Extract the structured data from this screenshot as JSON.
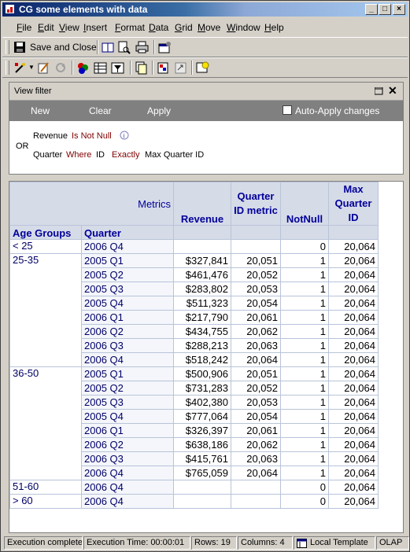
{
  "window": {
    "title": "CG some elements with data",
    "min_label": "_",
    "max_label": "□",
    "close_label": "×"
  },
  "menu": [
    "File",
    "Edit",
    "View",
    "Insert",
    "Format",
    "Data",
    "Grid",
    "Move",
    "Window",
    "Help"
  ],
  "toolbar": {
    "save_close_label": "Save and Close"
  },
  "view_filter": {
    "title": "View filter",
    "actions": {
      "new": "New",
      "clear": "Clear",
      "apply": "Apply",
      "auto_apply": "Auto-Apply changes"
    },
    "or_label": "OR",
    "condition1": {
      "field": "Revenue",
      "op": "Is Not Null"
    },
    "condition2": {
      "field": "Quarter",
      "where": "Where",
      "id": "ID",
      "op": "Exactly",
      "value": "Max Quarter ID"
    }
  },
  "grid": {
    "metrics_label": "Metrics",
    "row_headers": [
      "Age Groups",
      "Quarter"
    ],
    "columns": [
      {
        "label": "Revenue"
      },
      {
        "label": "Quarter ID metric"
      },
      {
        "label": "NotNull"
      },
      {
        "label": "Max Quarter ID"
      }
    ],
    "groups": [
      {
        "age": "< 25",
        "rows": [
          {
            "q": "2006 Q4",
            "rev": "",
            "qid": "",
            "nn": "0",
            "max": "20,064"
          }
        ]
      },
      {
        "age": "25-35",
        "rows": [
          {
            "q": "2005 Q1",
            "rev": "$327,841",
            "qid": "20,051",
            "nn": "1",
            "max": "20,064"
          },
          {
            "q": "2005 Q2",
            "rev": "$461,476",
            "qid": "20,052",
            "nn": "1",
            "max": "20,064"
          },
          {
            "q": "2005 Q3",
            "rev": "$283,802",
            "qid": "20,053",
            "nn": "1",
            "max": "20,064"
          },
          {
            "q": "2005 Q4",
            "rev": "$511,323",
            "qid": "20,054",
            "nn": "1",
            "max": "20,064"
          },
          {
            "q": "2006 Q1",
            "rev": "$217,790",
            "qid": "20,061",
            "nn": "1",
            "max": "20,064"
          },
          {
            "q": "2006 Q2",
            "rev": "$434,755",
            "qid": "20,062",
            "nn": "1",
            "max": "20,064"
          },
          {
            "q": "2006 Q3",
            "rev": "$288,213",
            "qid": "20,063",
            "nn": "1",
            "max": "20,064"
          },
          {
            "q": "2006 Q4",
            "rev": "$518,242",
            "qid": "20,064",
            "nn": "1",
            "max": "20,064"
          }
        ]
      },
      {
        "age": "36-50",
        "rows": [
          {
            "q": "2005 Q1",
            "rev": "$500,906",
            "qid": "20,051",
            "nn": "1",
            "max": "20,064"
          },
          {
            "q": "2005 Q2",
            "rev": "$731,283",
            "qid": "20,052",
            "nn": "1",
            "max": "20,064"
          },
          {
            "q": "2005 Q3",
            "rev": "$402,380",
            "qid": "20,053",
            "nn": "1",
            "max": "20,064"
          },
          {
            "q": "2005 Q4",
            "rev": "$777,064",
            "qid": "20,054",
            "nn": "1",
            "max": "20,064"
          },
          {
            "q": "2006 Q1",
            "rev": "$326,397",
            "qid": "20,061",
            "nn": "1",
            "max": "20,064"
          },
          {
            "q": "2006 Q2",
            "rev": "$638,186",
            "qid": "20,062",
            "nn": "1",
            "max": "20,064"
          },
          {
            "q": "2006 Q3",
            "rev": "$415,761",
            "qid": "20,063",
            "nn": "1",
            "max": "20,064"
          },
          {
            "q": "2006 Q4",
            "rev": "$765,059",
            "qid": "20,064",
            "nn": "1",
            "max": "20,064"
          }
        ]
      },
      {
        "age": "51-60",
        "rows": [
          {
            "q": "2006 Q4",
            "rev": "",
            "qid": "",
            "nn": "0",
            "max": "20,064"
          }
        ]
      },
      {
        "age": "> 60",
        "rows": [
          {
            "q": "2006 Q4",
            "rev": "",
            "qid": "",
            "nn": "0",
            "max": "20,064"
          }
        ]
      }
    ]
  },
  "status": {
    "state": "Execution complete",
    "time": "Execution Time: 00:00:01",
    "rows": "Rows: 19",
    "columns": "Columns: 4",
    "template": "Local Template",
    "olap": "OLAP"
  },
  "colors": {
    "header_bg": "#d6dbe8",
    "header_text": "#000099",
    "title_blue": "#0a246a",
    "condition_red": "#800000"
  }
}
